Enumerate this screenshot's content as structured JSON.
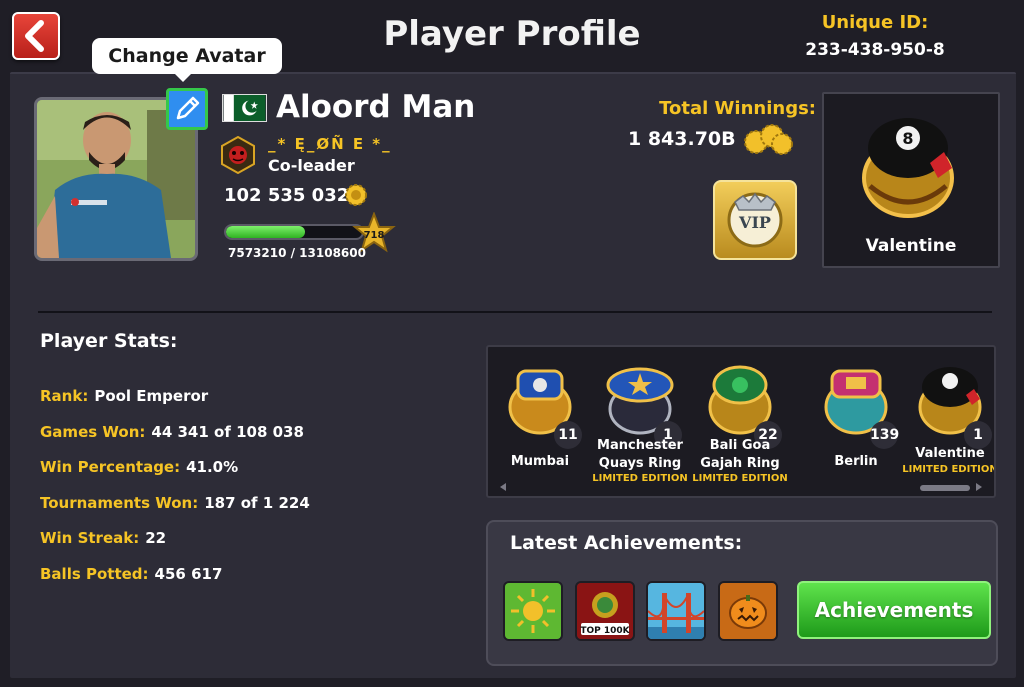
{
  "header": {
    "title": "Player Profile",
    "unique_id_label": "Unique ID:",
    "unique_id_value": "233-438-950-8",
    "back_icon": "back-arrow-icon"
  },
  "profile": {
    "change_avatar_tooltip": "Change Avatar",
    "edit_icon": "pencil-icon",
    "country_flag": "pakistan-flag",
    "player_name": "Aloord Man",
    "club_name": "_* Ę_ØÑ E *_",
    "club_role": "Co-leader",
    "coins": "102 535 032",
    "level": "718",
    "xp_text": "7573210 / 13108600",
    "xp_progress": 0.578,
    "total_winnings_label": "Total Winnings:",
    "total_winnings_value": "1 843.70B",
    "vip_label": "VIP",
    "cue_name": "Valentine"
  },
  "stats": {
    "title": "Player Stats:",
    "items": [
      {
        "label": "Rank:",
        "value": "Pool Emperor"
      },
      {
        "label": "Games Won:",
        "value": "44 341 of 108 038"
      },
      {
        "label": "Win Percentage:",
        "value": "41.0%"
      },
      {
        "label": "Tournaments Won:",
        "value": "187 of 1 224"
      },
      {
        "label": "Win Streak:",
        "value": "22"
      },
      {
        "label": "Balls Potted:",
        "value": "456 617"
      }
    ]
  },
  "rings": [
    {
      "name": "Mumbai",
      "count": "11",
      "edition": ""
    },
    {
      "name": "Manchester Quays Ring",
      "count": "1",
      "edition": "LIMITED EDITION"
    },
    {
      "name": "Bali Goa Gajah Ring",
      "count": "22",
      "edition": "LIMITED EDITION"
    },
    {
      "name": "Berlin",
      "count": "139",
      "edition": ""
    },
    {
      "name": "Valentine",
      "count": "1",
      "edition": "LIMITED EDITION"
    }
  ],
  "achievements": {
    "title": "Latest Achievements:",
    "badge_top100k_label": "TOP 100K",
    "button_label": "Achievements"
  },
  "colors": {
    "accent_gold": "#f6c425",
    "panel": "#2d2c37",
    "button_green": "#3cc534",
    "back_red": "#d6322a"
  }
}
